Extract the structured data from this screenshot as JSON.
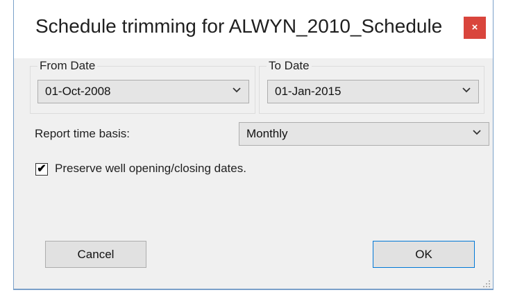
{
  "window": {
    "title": "Schedule trimming for ALWYN_2010_Schedule",
    "close_label": "×",
    "close_color": "#d9453c"
  },
  "from_group": {
    "label": "From Date",
    "value": "01-Oct-2008",
    "chevron": "⌄"
  },
  "to_group": {
    "label": "To Date",
    "value": "01-Jan-2015",
    "chevron": "⌄"
  },
  "report": {
    "label": "Report time basis:",
    "value": "Monthly",
    "chevron": "⌄"
  },
  "preserve": {
    "label": "Preserve well opening/closing dates.",
    "checked_glyph": "✔",
    "checked": true
  },
  "buttons": {
    "cancel_label": "Cancel",
    "ok_label": "OK"
  },
  "icons": {
    "close": "close-icon",
    "dropdown": "chevron-down-icon",
    "check": "checkmark-icon",
    "grip": "resize-grip-icon"
  }
}
